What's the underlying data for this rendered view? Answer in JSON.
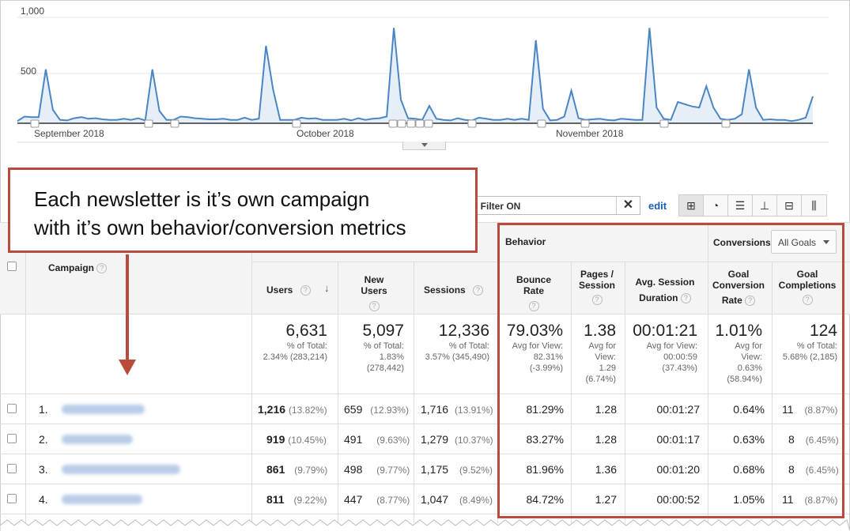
{
  "chart_data": {
    "type": "area",
    "y_ticks": [
      "1,000",
      "500"
    ],
    "ylim": [
      0,
      1000
    ],
    "x_labels": [
      "September 2018",
      "October 2018",
      "November 2018"
    ],
    "values": [
      20,
      60,
      55,
      55,
      480,
      120,
      30,
      25,
      45,
      55,
      40,
      45,
      35,
      30,
      30,
      40,
      30,
      45,
      25,
      480,
      110,
      30,
      30,
      60,
      55,
      45,
      40,
      35,
      35,
      40,
      30,
      30,
      50,
      30,
      40,
      690,
      300,
      30,
      30,
      30,
      50,
      40,
      45,
      30,
      30,
      30,
      40,
      25,
      45,
      30,
      40,
      45,
      60,
      850,
      210,
      45,
      40,
      30,
      155,
      40,
      30,
      25,
      45,
      30,
      25,
      50,
      40,
      30,
      30,
      40,
      30,
      40,
      30,
      740,
      130,
      25,
      30,
      60,
      290,
      45,
      30,
      35,
      40,
      30,
      25,
      40,
      35,
      30,
      30,
      850,
      140,
      40,
      30,
      190,
      170,
      150,
      140,
      330,
      140,
      40,
      30,
      40,
      80,
      480,
      140,
      30,
      35,
      30,
      30,
      20,
      30,
      50,
      240
    ],
    "grid": true,
    "line_color": "#4a86c5",
    "fill_color": "#e6eef8"
  },
  "toolbar": {
    "filter_text": "d Filter ON",
    "clear_glyph": "✕",
    "edit_label": "edit",
    "views": [
      "⊞",
      "◔",
      "☰",
      "⊥",
      "⊟",
      "⫼"
    ]
  },
  "table": {
    "group_behavior": "Behavior",
    "group_conversions": "Conversions",
    "goal_select": "All Goals",
    "help_glyph": "?",
    "sort_glyph": "↓",
    "headers": {
      "campaign": "Campaign",
      "users": "Users",
      "new_users": "New Users",
      "sessions": "Sessions",
      "bounce_rate": "Bounce Rate",
      "pages_l1": "Pages /",
      "pages_l2": "Session",
      "avg_l1": "Avg. Session",
      "avg_l2": "Duration",
      "gcr_l1": "Goal",
      "gcr_l2": "Conversion",
      "gcr_l3": "Rate",
      "gc_l1": "Goal",
      "gc_l2": "Completions"
    },
    "totals": {
      "users": {
        "big": "6,631",
        "l1": "% of Total:",
        "l2": "2.34% (283,214)"
      },
      "new_users": {
        "big": "5,097",
        "l1": "% of Total:",
        "l2": "1.83%",
        "l3": "(278,442)"
      },
      "sessions": {
        "big": "12,336",
        "l1": "% of Total:",
        "l2": "3.57% (345,490)"
      },
      "bounce_rate": {
        "big": "79.03%",
        "l1": "Avg for View:",
        "l2": "82.31%",
        "l3": "(-3.99%)"
      },
      "pages": {
        "big": "1.38",
        "l1": "Avg for",
        "l2": "View:",
        "l3": "1.29",
        "l4": "(6.74%)"
      },
      "avg_dur": {
        "big": "00:01:21",
        "l1": "Avg for View:",
        "l2": "00:00:59",
        "l3": "(37.43%)"
      },
      "gcr": {
        "big": "1.01%",
        "l1": "Avg for",
        "l2": "View:",
        "l3": "0.63%",
        "l4": "(58.94%)"
      },
      "gc": {
        "big": "124",
        "l1": "% of Total:",
        "l2": "5.68% (2,185)"
      }
    },
    "rows": [
      {
        "idx": "1.",
        "users": "1,216",
        "users_pct": "(13.82%)",
        "new": "659",
        "new_pct": "(12.93%)",
        "sess": "1,716",
        "sess_pct": "(13.91%)",
        "bounce": "81.29%",
        "pages": "1.28",
        "dur": "00:01:27",
        "gcr": "0.64%",
        "gc": "11",
        "gc_pct": "(8.87%)"
      },
      {
        "idx": "2.",
        "users": "919",
        "users_pct": "(10.45%)",
        "new": "491",
        "new_pct": "(9.63%)",
        "sess": "1,279",
        "sess_pct": "(10.37%)",
        "bounce": "83.27%",
        "pages": "1.28",
        "dur": "00:01:17",
        "gcr": "0.63%",
        "gc": "8",
        "gc_pct": "(6.45%)"
      },
      {
        "idx": "3.",
        "users": "861",
        "users_pct": "(9.79%)",
        "new": "498",
        "new_pct": "(9.77%)",
        "sess": "1,175",
        "sess_pct": "(9.52%)",
        "bounce": "81.96%",
        "pages": "1.36",
        "dur": "00:01:20",
        "gcr": "0.68%",
        "gc": "8",
        "gc_pct": "(6.45%)"
      },
      {
        "idx": "4.",
        "users": "811",
        "users_pct": "(9.22%)",
        "new": "447",
        "new_pct": "(8.77%)",
        "sess": "1,047",
        "sess_pct": "(8.49%)",
        "bounce": "84.72%",
        "pages": "1.27",
        "dur": "00:00:52",
        "gcr": "1.05%",
        "gc": "11",
        "gc_pct": "(8.87%)"
      }
    ]
  },
  "annotation": {
    "line1": "Each newsletter is it’s own campaign",
    "line2": "with it’s own behavior/conversion metrics"
  }
}
